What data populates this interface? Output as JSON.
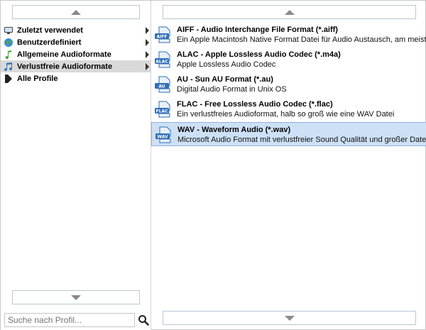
{
  "categories": [
    {
      "label": "Zuletzt verwendet",
      "icon": "monitor-icon"
    },
    {
      "label": "Benutzerdefiniert",
      "icon": "globe-icon"
    },
    {
      "label": "Allgemeine Audioformate",
      "icon": "music-note-green-icon"
    },
    {
      "label": "Verlustfreie Audioformate",
      "icon": "music-note-blue-icon",
      "selected": true
    },
    {
      "label": "Alle Profile",
      "icon": "play-icon"
    }
  ],
  "search": {
    "placeholder": "Suche nach Profil..."
  },
  "formats": [
    {
      "title": "AIFF - Audio Interchange File Format (*.aiff)",
      "desc": "Ein Apple Macintosh Native Format Datei für Audio Austausch, am meisten i...",
      "badge": "AIFF"
    },
    {
      "title": "ALAC - Apple Lossless Audio Codec (*.m4a)",
      "desc": "Apple Lossless Audio Codec",
      "badge": "ALAC"
    },
    {
      "title": "AU - Sun AU Format (*.au)",
      "desc": "Digital Audio Format in Unix OS",
      "badge": "AU"
    },
    {
      "title": "FLAC - Free Lossless Audio Codec (*.flac)",
      "desc": "Ein verlustfreies Audioformat, halb so groß wie eine WAV Datei",
      "badge": "FLAC"
    },
    {
      "title": "WAV - Waveform Audio (*.wav)",
      "desc": "Microsoft Audio Format mit verlustfreier Sound Qualität und großer Dateigröße",
      "badge": "WAV",
      "selected": true
    }
  ],
  "colors": {
    "selected_bg": "#cde0f5",
    "selected_border": "#8fb3dc",
    "category_selected_bg": "#d9d9d9",
    "icon_blue": "#2f6fb6"
  }
}
